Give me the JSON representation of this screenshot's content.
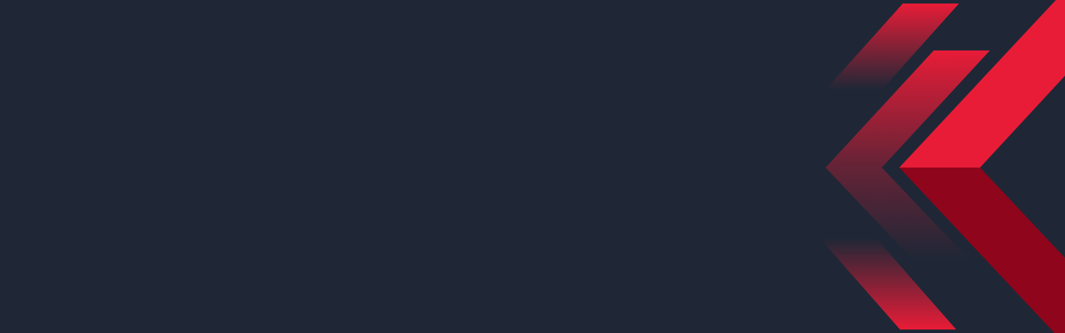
{
  "banner": {
    "colors": {
      "background": "#1f2736",
      "accent": "#e81c37",
      "accent_dark": "#8f051c",
      "chevron_ghost": "#e81c37"
    },
    "decoration": "chevron-arrows"
  }
}
